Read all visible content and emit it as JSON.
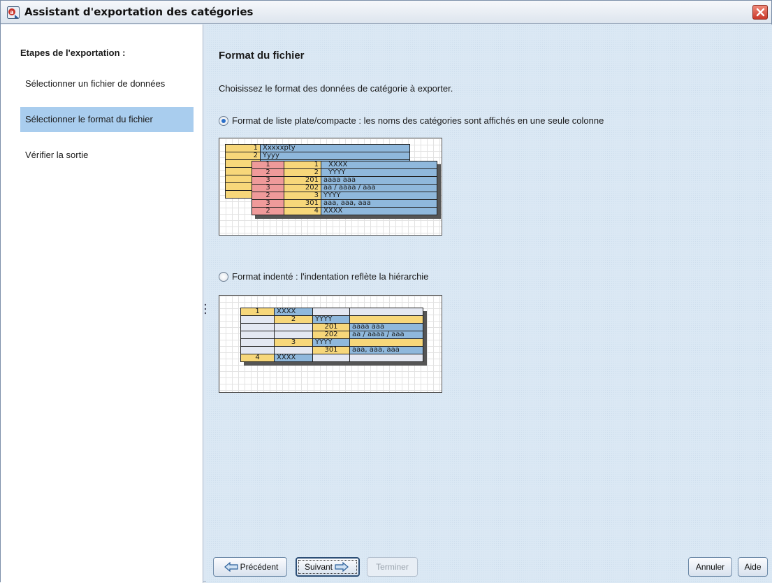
{
  "window": {
    "title": "Assistant d'exportation des catégories"
  },
  "sidebar": {
    "title": "Etapes de l'exportation :",
    "steps": [
      {
        "label": "Sélectionner un fichier de données"
      },
      {
        "label": "Sélectionner le format du fichier"
      },
      {
        "label": "Vérifier la sortie"
      }
    ]
  },
  "content": {
    "title": "Format du fichier",
    "instruction": "Choisissez le format des données de catégorie à exporter.",
    "options": [
      {
        "label": "Format de liste plate/compacte : les noms des catégories sont affichés en une seule colonne",
        "selected": true
      },
      {
        "label": "Format indenté : l'indentation reflète la hiérarchie",
        "selected": false
      }
    ],
    "flat_preview": {
      "back_rows": [
        {
          "id": "1",
          "name": "Xxxxxpty"
        },
        {
          "id": "2",
          "name": "Yyyy"
        }
      ],
      "rows": [
        [
          "1",
          "1",
          "XXXX"
        ],
        [
          "2",
          "2",
          "YYYY"
        ],
        [
          "3",
          "201",
          "aaaa aaa"
        ],
        [
          "3",
          "202",
          "aa / aaaa / aaa"
        ],
        [
          "2",
          "3",
          "YYYY"
        ],
        [
          "3",
          "301",
          "aaa, aaa, aaa"
        ],
        [
          "2",
          "4",
          "XXXX"
        ]
      ]
    },
    "indent_preview": {
      "rows": [
        [
          "1",
          "XXXX",
          "",
          ""
        ],
        [
          "",
          "2",
          "YYYY",
          ""
        ],
        [
          "",
          "",
          "201",
          "aaaa aaa"
        ],
        [
          "",
          "",
          "202",
          "aa / aaaa / aaa"
        ],
        [
          "",
          "3",
          "YYYY",
          ""
        ],
        [
          "",
          "",
          "301",
          "aaa, aaa, aaa"
        ],
        [
          "4",
          "XXXX",
          "",
          ""
        ]
      ]
    }
  },
  "buttons": {
    "previous": "Précédent",
    "next": "Suivant",
    "finish": "Terminer",
    "cancel": "Annuler",
    "help": "Aide"
  },
  "colors": {
    "selected_step": "#a9cdee",
    "panel_bg": "#dbe8f4",
    "cell_yellow": "#f7d77a",
    "cell_blue": "#8fb8dc",
    "cell_pink": "#ef9a9a"
  }
}
